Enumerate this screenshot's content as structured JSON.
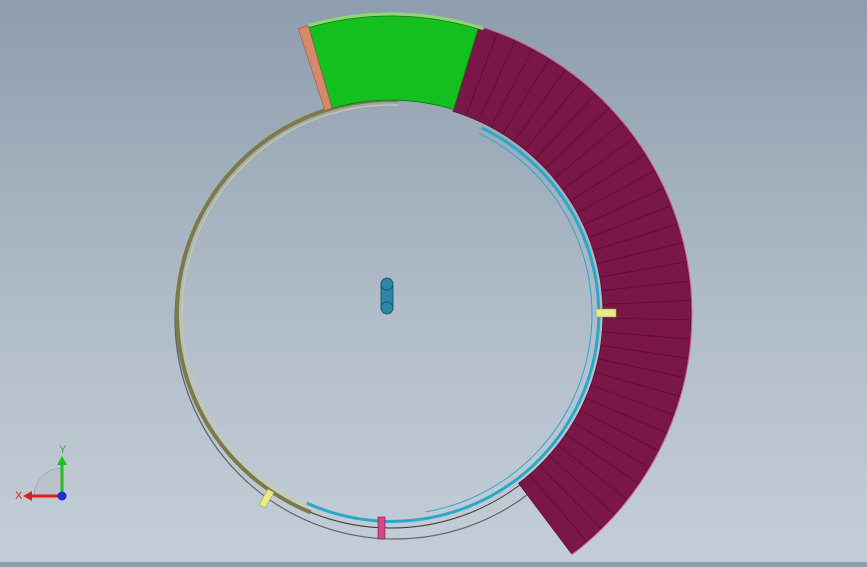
{
  "scene": {
    "background_top": "#8e9dad",
    "background_bottom": "#c4ced8",
    "colors": {
      "ring_outline": "#3a3a2e",
      "ring_olive": "#7d7a45",
      "ring_light": "#c9cf92",
      "ring_cyan": "#2aa7c9",
      "spiral_panel": "#7b1747",
      "spiral_edge": "#5a0f33",
      "green_block": "#14c01e",
      "salmon_strip": "#d7876a",
      "yellow_marker": "#e6ec8a",
      "pink_marker": "#d04a86",
      "hub": "#2b86a8"
    },
    "spiral_segment_count": 34
  },
  "triad": {
    "x_label": "X",
    "y_label": "Y",
    "x_color": "#e02020",
    "y_color": "#20c020",
    "z_color": "#1a2fd6"
  }
}
